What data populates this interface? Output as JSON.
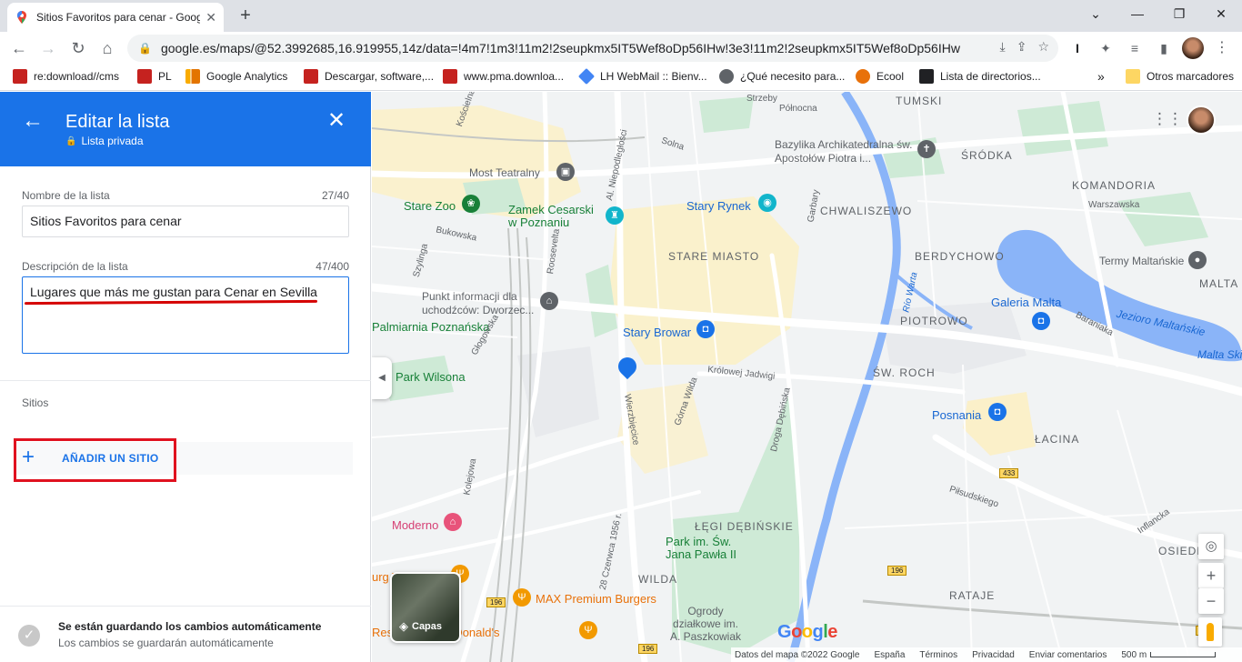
{
  "browser": {
    "tab_title": "Sitios Favoritos para cenar - Google",
    "url": "google.es/maps/@52.3992685,16.919955,14z/data=!4m7!1m3!11m2!2seupkmx5IT5Wef8oDp56IHw!3e3!11m2!2seupkmx5IT5Wef8oDp56IHw!..."
  },
  "bookmarks": [
    {
      "label": "re:download//cms",
      "color": "#c5221f"
    },
    {
      "label": "PL",
      "color": "#c5221f"
    },
    {
      "label": "Google Analytics",
      "color": "#f9ab00"
    },
    {
      "label": "Descargar, software,...",
      "color": "#c5221f"
    },
    {
      "label": "www.pma.downloa...",
      "color": "#c5221f"
    },
    {
      "label": "LH WebMail :: Bienv...",
      "color": "#4285f4"
    },
    {
      "label": "¿Qué necesito para...",
      "color": "#5f6368"
    },
    {
      "label": "Ecool",
      "color": "#e8710a"
    },
    {
      "label": "Lista de directorios...",
      "color": "#202124"
    }
  ],
  "bookmarks_overflow": "»",
  "bookmarks_other": "Otros marcadores",
  "panel": {
    "title": "Editar la lista",
    "subtitle": "Lista privada",
    "name_label": "Nombre de la lista",
    "name_count": "27/40",
    "name_value": "Sitios Favoritos para cenar",
    "desc_label": "Descripción de la lista",
    "desc_count": "47/400",
    "desc_value": "Lugares que más me gustan para Cenar en Sevilla",
    "places_label": "Sitios",
    "add_place": "AÑADIR UN SITIO",
    "save_title": "Se están guardando los cambios automáticamente",
    "save_sub": "Los cambios se guardarán automáticamente"
  },
  "map": {
    "districts": [
      "STARE MIASTO",
      "CHWALISZEWO",
      "BERDYCHOWO",
      "PIOTROWO",
      "ŚW. ROCH",
      "ŚRÓDKA",
      "KOMANDORIA",
      "TUMSKI",
      "ŁACINA",
      "ŁĘGI DĘBIŃSKIE",
      "WILDA",
      "RATAJE",
      "OSIEDLE",
      "MALTA"
    ],
    "pois": {
      "most_teatralny": "Most Teatralny",
      "stare_zoo": "Stare Zoo",
      "zamek": "Zamek Cesarski w Poznaniu",
      "stary_rynek": "Stary Rynek",
      "bazylika": "Bazylika Archikatedralna św. Apostołów Piotra i...",
      "punkt": "Punkt informacji dla uchodźców: Dworzec...",
      "palmiarnia": "Palmiarnia Poznańska",
      "stary_browar": "Stary Browar",
      "park_wilsona": "Park Wilsona",
      "galeria_malta": "Galeria Malta",
      "termy": "Termy Maltańskie",
      "jezioro": "Jezioro Maltańskie",
      "malta_ski": "Malta Ski",
      "posnania": "Posnania",
      "moderno": "Moderno",
      "park_jp2": "Park im. Św. Jana Pawła II",
      "max_burgers": "MAX Premium Burgers",
      "ogrody": "Ogrody działkowe im. A. Paszkowiak",
      "mcdonalds": "Restauracja McDonald's",
      "rio_warta": "Río Warta",
      "burg": "urg T"
    },
    "streets": [
      "Solna",
      "Północna",
      "Warszawska",
      "Bukowska",
      "Szylinga",
      "Głogowska",
      "Wierzbięcice",
      "Górna Wilda",
      "Królowej Jadwigi",
      "Droga Dębińska",
      "Garbary",
      "Baraniaka",
      "Piłsudskiego",
      "Inflancka",
      "Kolejowa",
      "28 Czerwca 1956 r.",
      "Al. Niepodległości",
      "Roosevelta",
      "Strzeby",
      "Kościelna"
    ],
    "road_signs": [
      "433",
      "196",
      "196",
      "196",
      "196"
    ],
    "layers_label": "Capas",
    "google_logo": "Google",
    "footer": {
      "data": "Datos del mapa ©2022 Google",
      "country": "España",
      "terms": "Términos",
      "privacy": "Privacidad",
      "feedback": "Enviar comentarios",
      "scale": "500 m"
    }
  }
}
